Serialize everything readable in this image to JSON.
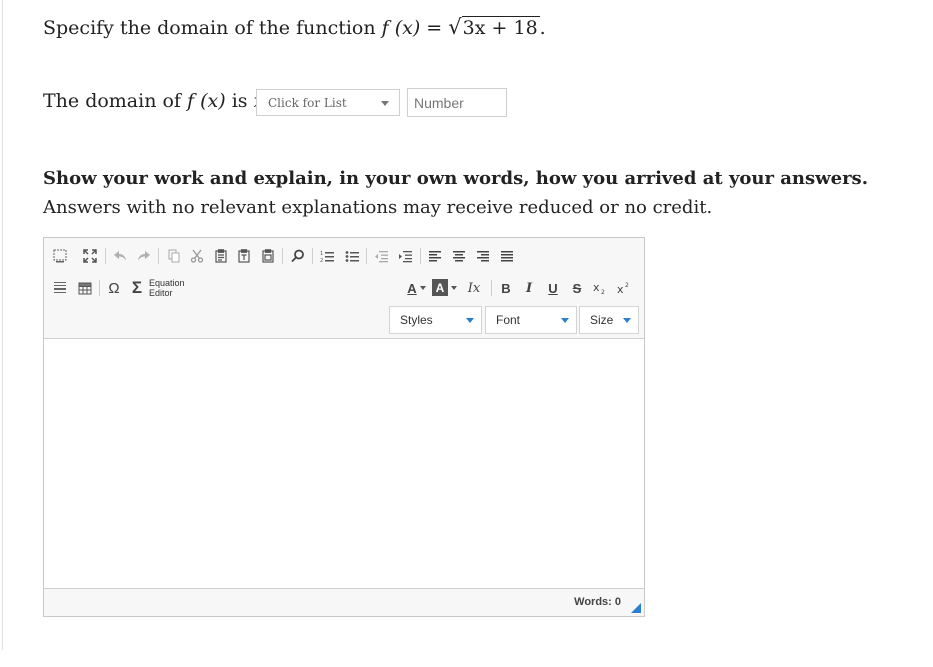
{
  "question": {
    "prompt_text": "Specify the domain of the function",
    "function_lhs": "f (x) =",
    "function_radicand": "3x + 18",
    "function_end": "."
  },
  "answer_line": {
    "prefix": "The domain of",
    "function": "f (x)",
    "middle": "is",
    "variable": "x",
    "dropdown_label": "Click for List",
    "number_placeholder": "Number"
  },
  "instructions": {
    "bold": "Show your work and explain, in your own words, how you arrived at your answers.",
    "rest": " Answers with no relevant explanations may receive reduced or no credit."
  },
  "editor": {
    "equation_label_line1": "Equation",
    "equation_label_line2": "Editor",
    "styles_label": "Styles",
    "font_label": "Font",
    "size_label": "Size",
    "bold_label": "B",
    "italic_label": "I",
    "underline_label": "U",
    "strike_label": "S",
    "font_color_label": "A",
    "bg_color_label": "A",
    "clear_format_label": "Ix",
    "omega_label": "Ω",
    "sigma_label": "Σ",
    "word_count": "Words: 0"
  },
  "colors": {
    "accent": "#2a80d0",
    "border": "#c9c9c9",
    "toolbar_bg": "#f7f7f7"
  }
}
